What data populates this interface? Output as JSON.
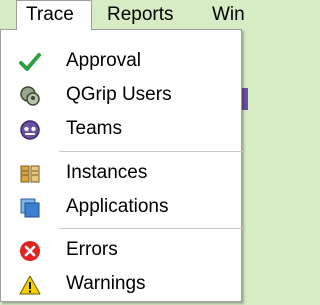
{
  "menubar": {
    "items": [
      {
        "label": "Trace"
      },
      {
        "label": "Reports"
      },
      {
        "label": "Win"
      }
    ]
  },
  "trace_menu": {
    "groups": [
      [
        {
          "label": "Approval",
          "icon": "check-icon"
        },
        {
          "label": "QGrip Users",
          "icon": "users-icon"
        },
        {
          "label": "Teams",
          "icon": "teams-icon"
        }
      ],
      [
        {
          "label": "Instances",
          "icon": "instances-icon"
        },
        {
          "label": "Applications",
          "icon": "applications-icon"
        }
      ],
      [
        {
          "label": "Errors",
          "icon": "error-icon"
        },
        {
          "label": "Warnings",
          "icon": "warning-icon"
        }
      ]
    ]
  },
  "colors": {
    "background": "#d7ebc4",
    "check": "#2ea043",
    "error": "#e02424",
    "warning": "#f5d000",
    "accent_purple": "#6b4fa0"
  }
}
